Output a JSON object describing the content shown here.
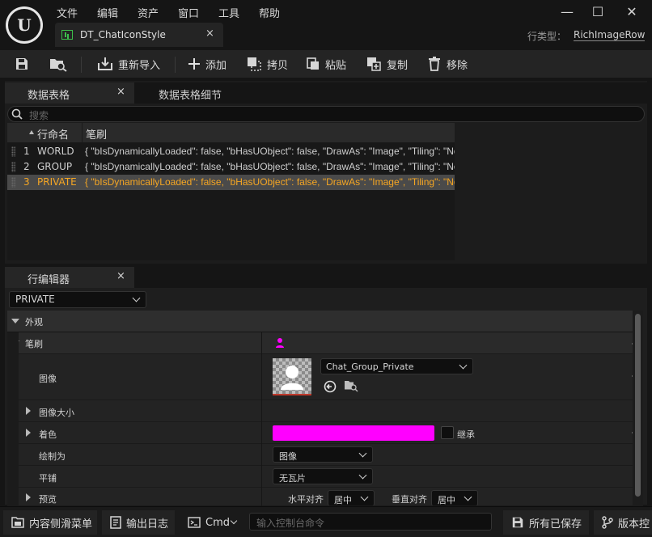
{
  "menu": [
    "文件",
    "编辑",
    "资产",
    "窗口",
    "工具",
    "帮助"
  ],
  "logo_text": "U",
  "window_controls": {
    "minimize": "—",
    "maximize": "☐",
    "close": "✕"
  },
  "document_tab": {
    "label": "DT_ChatIconStyle",
    "close": "×"
  },
  "row_type": {
    "label": "行类型：",
    "value": "RichImageRow"
  },
  "toolbar": {
    "reimport": "重新导入",
    "add": "添加",
    "copy": "拷贝",
    "paste": "粘贴",
    "duplicate": "复制",
    "remove": "移除"
  },
  "table_panel": {
    "tab_data_table": "数据表格",
    "tab_details": "数据表格细节",
    "close": "×",
    "search_placeholder": "搜索",
    "columns": [
      "行命名",
      "笔刷"
    ],
    "rows": [
      {
        "num": "1",
        "name": "WORLD",
        "brush": "{ \"bIsDynamicallyLoaded\": false, \"bHasUObject\": false, \"DrawAs\": \"Image\", \"Tiling\": \"No"
      },
      {
        "num": "2",
        "name": "GROUP",
        "brush": "{ \"bIsDynamicallyLoaded\": false, \"bHasUObject\": false, \"DrawAs\": \"Image\", \"Tiling\": \"No"
      },
      {
        "num": "3",
        "name": "PRIVATE",
        "brush": "{ \"bIsDynamicallyLoaded\": false, \"bHasUObject\": false, \"DrawAs\": \"Image\", \"Tiling\": \"No"
      }
    ],
    "selected_row_index": 2
  },
  "row_editor": {
    "tab": "行编辑器",
    "close": "×",
    "row_select": "PRIVATE",
    "section_appearance": "外观",
    "brush_label": "笔刷",
    "image_label": "图像",
    "image_asset": "Chat_Group_Private",
    "image_size_label": "图像大小",
    "tint_label": "着色",
    "tint_color": "#ff00ff",
    "inherit_label": "继承",
    "draw_as_label": "绘制为",
    "draw_as_value": "图像",
    "tiling_label": "平铺",
    "tiling_value": "无瓦片",
    "preview_label": "预览",
    "h_align_label": "水平对齐",
    "h_align_value": "居中",
    "v_align_label": "垂直对齐",
    "v_align_value": "居中"
  },
  "statusbar": {
    "content_drawer": "内容侧滑菜单",
    "output_log": "输出日志",
    "cmd": "Cmd",
    "console_placeholder": "输入控制台命令",
    "all_saved": "所有已保存",
    "version_control": "版本控"
  },
  "colors": {
    "selected_row_text": "#f5a623",
    "accent_magenta": "#ff00ff",
    "tab_icon_green": "#3cbf4a"
  }
}
